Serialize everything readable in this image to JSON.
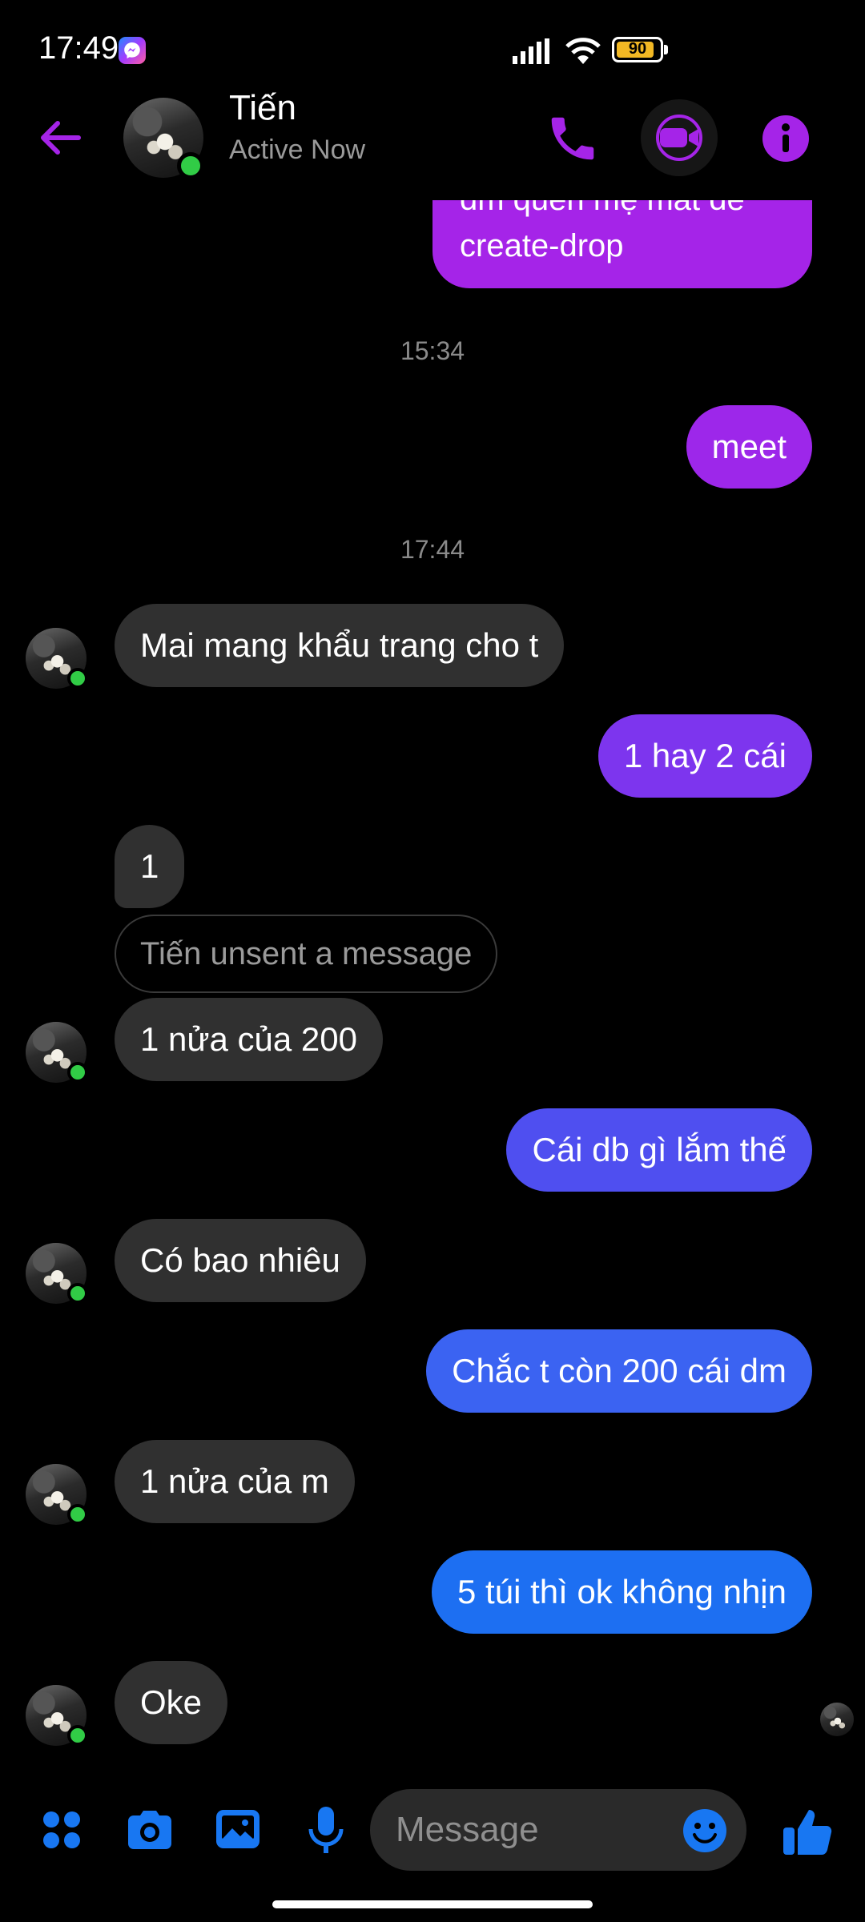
{
  "status_bar": {
    "time": "17:49",
    "battery": "90"
  },
  "header": {
    "contact_name": "Tiến",
    "contact_status": "Active Now"
  },
  "colors": {
    "accent": "#a524e8",
    "in_bubble": "#303030",
    "online": "#31cc46",
    "composer_blue": "#1877f2"
  },
  "messages": {
    "clipped_top": {
      "line1": "dm quên mẹ mất đe",
      "line2": "create-drop"
    },
    "timestamp_1": "15:34",
    "meet": "meet",
    "timestamp_2": "17:44",
    "m1": "Mai mang khẩu trang cho t",
    "m2": "1 hay 2 cái",
    "m3": "1",
    "unsent": "Tiến unsent a message",
    "m4": "1 nửa của 200",
    "m5": "Cái db gì lắm thế",
    "m6": "Có bao nhiêu",
    "m7": "Chắc t còn 200 cái dm",
    "m8": "1 nửa của m",
    "m9": "5 túi thì ok không nhịn",
    "m10": "Oke"
  },
  "composer": {
    "placeholder": "Message"
  }
}
